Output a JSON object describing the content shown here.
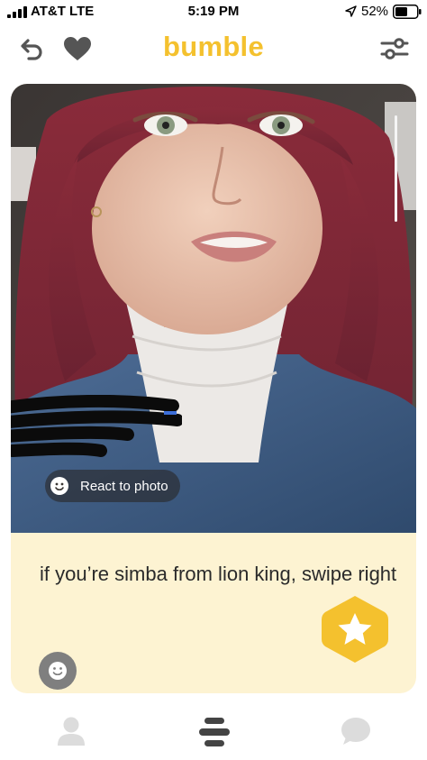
{
  "status_bar": {
    "carrier": "AT&T  LTE",
    "time": "5:19 PM",
    "battery": "52%"
  },
  "header": {
    "logo": "bumble",
    "back_icon": "undo-icon",
    "heart_icon": "heart-icon",
    "filter_icon": "filter-sliders-icon"
  },
  "profile_card": {
    "react_label": "React to photo",
    "prompt_answer": "if you’re simba from lion king, swipe right"
  },
  "bottom_nav": {
    "items": [
      "profile-icon",
      "swipe-stack-icon",
      "chat-bubble-icon"
    ]
  },
  "colors": {
    "brand_yellow": "#f4c12e",
    "card_bg": "#fdf3d2",
    "icon_gray": "#555555",
    "nav_inactive": "#dcdcdc",
    "nav_active": "#444444"
  }
}
